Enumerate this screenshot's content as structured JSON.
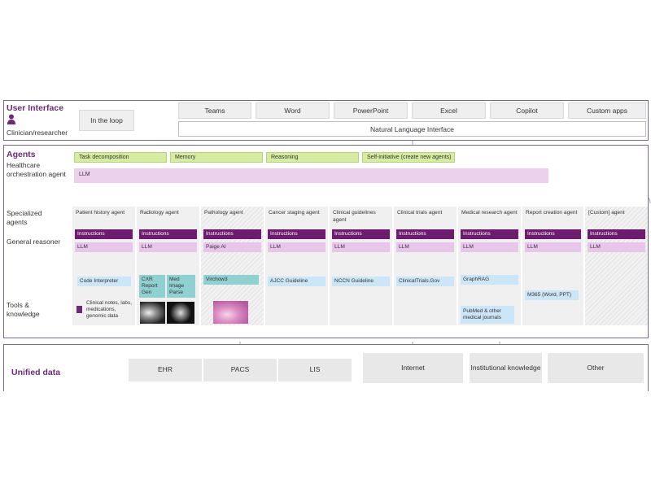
{
  "ui": {
    "title": "User Interface",
    "subtitle": "Clinician/researcher",
    "in_the_loop": "In the loop",
    "apps": [
      "Teams",
      "Word",
      "PowerPoint",
      "Excel",
      "Copilot",
      "Custom apps"
    ],
    "nli": "Natural Language Interface"
  },
  "agents": {
    "title": "Agents",
    "orchestrator_label": "Healthcare orchestration agent",
    "capabilities": [
      "Task decomposition",
      "Memory",
      "Reasoning",
      "Self-initiative (create new agents)"
    ],
    "llm": "LLM",
    "specialized_label": "Specialized agents",
    "general_reasoner_label": "General reasoner",
    "tools_label": "Tools & knowledge",
    "instructions": "Instructions",
    "columns": [
      {
        "name": "Patient history agent",
        "tools": [
          "Code Interpreter",
          "Clinical notes, labs, medications, genomic data"
        ]
      },
      {
        "name": "Radiology agent",
        "tools": [
          "CXR Report Gen",
          "Med Image Parse"
        ]
      },
      {
        "name": "Pathology agent",
        "tools": [
          "Paige AI",
          "Virchow3"
        ]
      },
      {
        "name": "Cancer staging agent",
        "tools": [
          "AJCC Guideline"
        ]
      },
      {
        "name": "Clinical guidelines agent",
        "tools": [
          "NCCN Guideline"
        ]
      },
      {
        "name": "Clinical trials agent",
        "tools": [
          "ClinicalTrials.Gov"
        ]
      },
      {
        "name": "Medical research agent",
        "tools": [
          "GraphRAG",
          "PubMed & other medical journals"
        ]
      },
      {
        "name": "Report creation agent",
        "tools": [
          "M365 (Word, PPT)"
        ]
      },
      {
        "name": "[Custom] agent",
        "tools": []
      }
    ]
  },
  "unified": {
    "title": "Unified data",
    "sources": [
      "EHR",
      "PACS",
      "LIS",
      "Internet",
      "Institutional knowledge",
      "Other"
    ]
  },
  "colors": {
    "title_purple": "#6b2a78",
    "instructions": "#6e1a6e",
    "llm": "#e8c6ea",
    "capability": "#d6eca0",
    "tool": "#cbe6f7",
    "tool_teal": "#8fd0d0"
  }
}
